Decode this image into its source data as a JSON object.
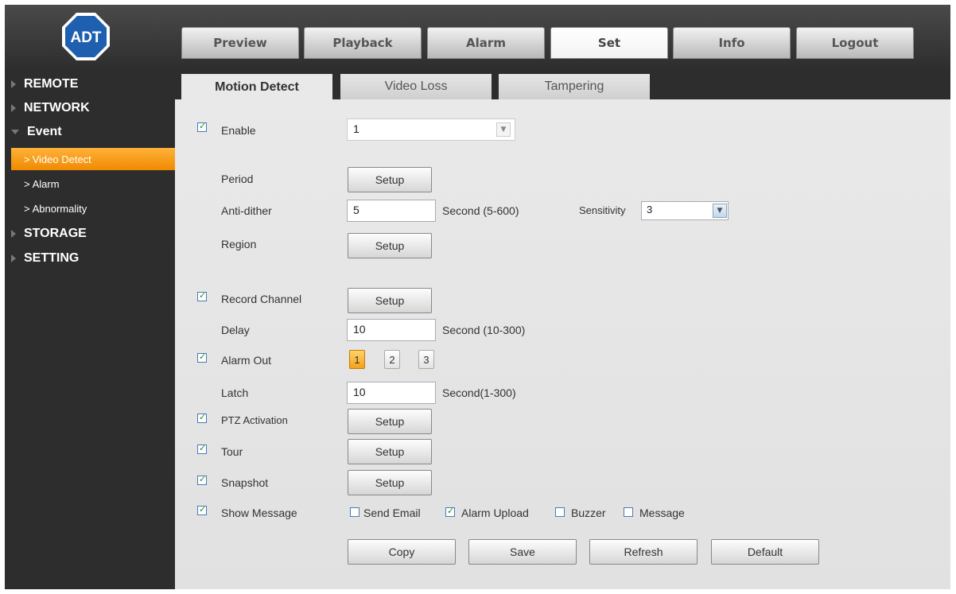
{
  "top_tabs": [
    {
      "label": "Preview",
      "active": false
    },
    {
      "label": "Playback",
      "active": false
    },
    {
      "label": "Alarm",
      "active": false
    },
    {
      "label": "Set",
      "active": true
    },
    {
      "label": "Info",
      "active": false
    },
    {
      "label": "Logout",
      "active": false
    }
  ],
  "logo": {
    "text": "ADT"
  },
  "sidebar": {
    "items": [
      {
        "label": "REMOTE",
        "type": "category"
      },
      {
        "label": "NETWORK",
        "type": "category"
      },
      {
        "label": "Event",
        "type": "category",
        "expanded": true
      },
      {
        "label": "Video Detect",
        "type": "sub",
        "selected": true
      },
      {
        "label": "Alarm",
        "type": "sub"
      },
      {
        "label": "Abnormality",
        "type": "sub"
      },
      {
        "label": "STORAGE",
        "type": "category"
      },
      {
        "label": "SETTING",
        "type": "category"
      }
    ]
  },
  "sub_tabs": [
    {
      "label": "Motion Detect",
      "active": true
    },
    {
      "label": "Video Loss",
      "active": false
    },
    {
      "label": "Tampering",
      "active": false
    }
  ],
  "form": {
    "enable": {
      "label": "Enable",
      "checked": true,
      "channel_value": "1"
    },
    "period": {
      "label": "Period",
      "button": "Setup"
    },
    "anti_dither": {
      "label": "Anti-dither",
      "value": "5",
      "unit": "Second (5-600)"
    },
    "sensitivity": {
      "label": "Sensitivity",
      "value": "3"
    },
    "region": {
      "label": "Region",
      "button": "Setup"
    },
    "record_channel": {
      "label": "Record Channel",
      "checked": true,
      "button": "Setup"
    },
    "delay": {
      "label": "Delay",
      "value": "10",
      "unit": "Second (10-300)"
    },
    "alarm_out": {
      "label": "Alarm Out",
      "checked": true,
      "outputs": [
        "1",
        "2",
        "3"
      ],
      "active_output": "1"
    },
    "latch": {
      "label": "Latch",
      "value": "10",
      "unit": "Second(1-300)"
    },
    "ptz_activation": {
      "label": "PTZ Activation",
      "checked": true,
      "button": "Setup"
    },
    "tour": {
      "label": "Tour",
      "checked": true,
      "button": "Setup"
    },
    "snapshot": {
      "label": "Snapshot",
      "checked": true,
      "button": "Setup"
    },
    "show_message": {
      "label": "Show Message",
      "checked": true
    },
    "send_email": {
      "label": "Send Email",
      "checked": false
    },
    "alarm_upload": {
      "label": "Alarm Upload",
      "checked": true
    },
    "buzzer": {
      "label": "Buzzer",
      "checked": false
    },
    "message": {
      "label": "Message",
      "checked": false
    }
  },
  "actions": {
    "copy": "Copy",
    "save": "Save",
    "refresh": "Refresh",
    "default": "Default"
  },
  "colors": {
    "accent": "#f39c12",
    "sidebar_bg": "#2d2d2d",
    "panel_bg": "#e6e6e6",
    "logo_blue": "#1f5fb0"
  }
}
